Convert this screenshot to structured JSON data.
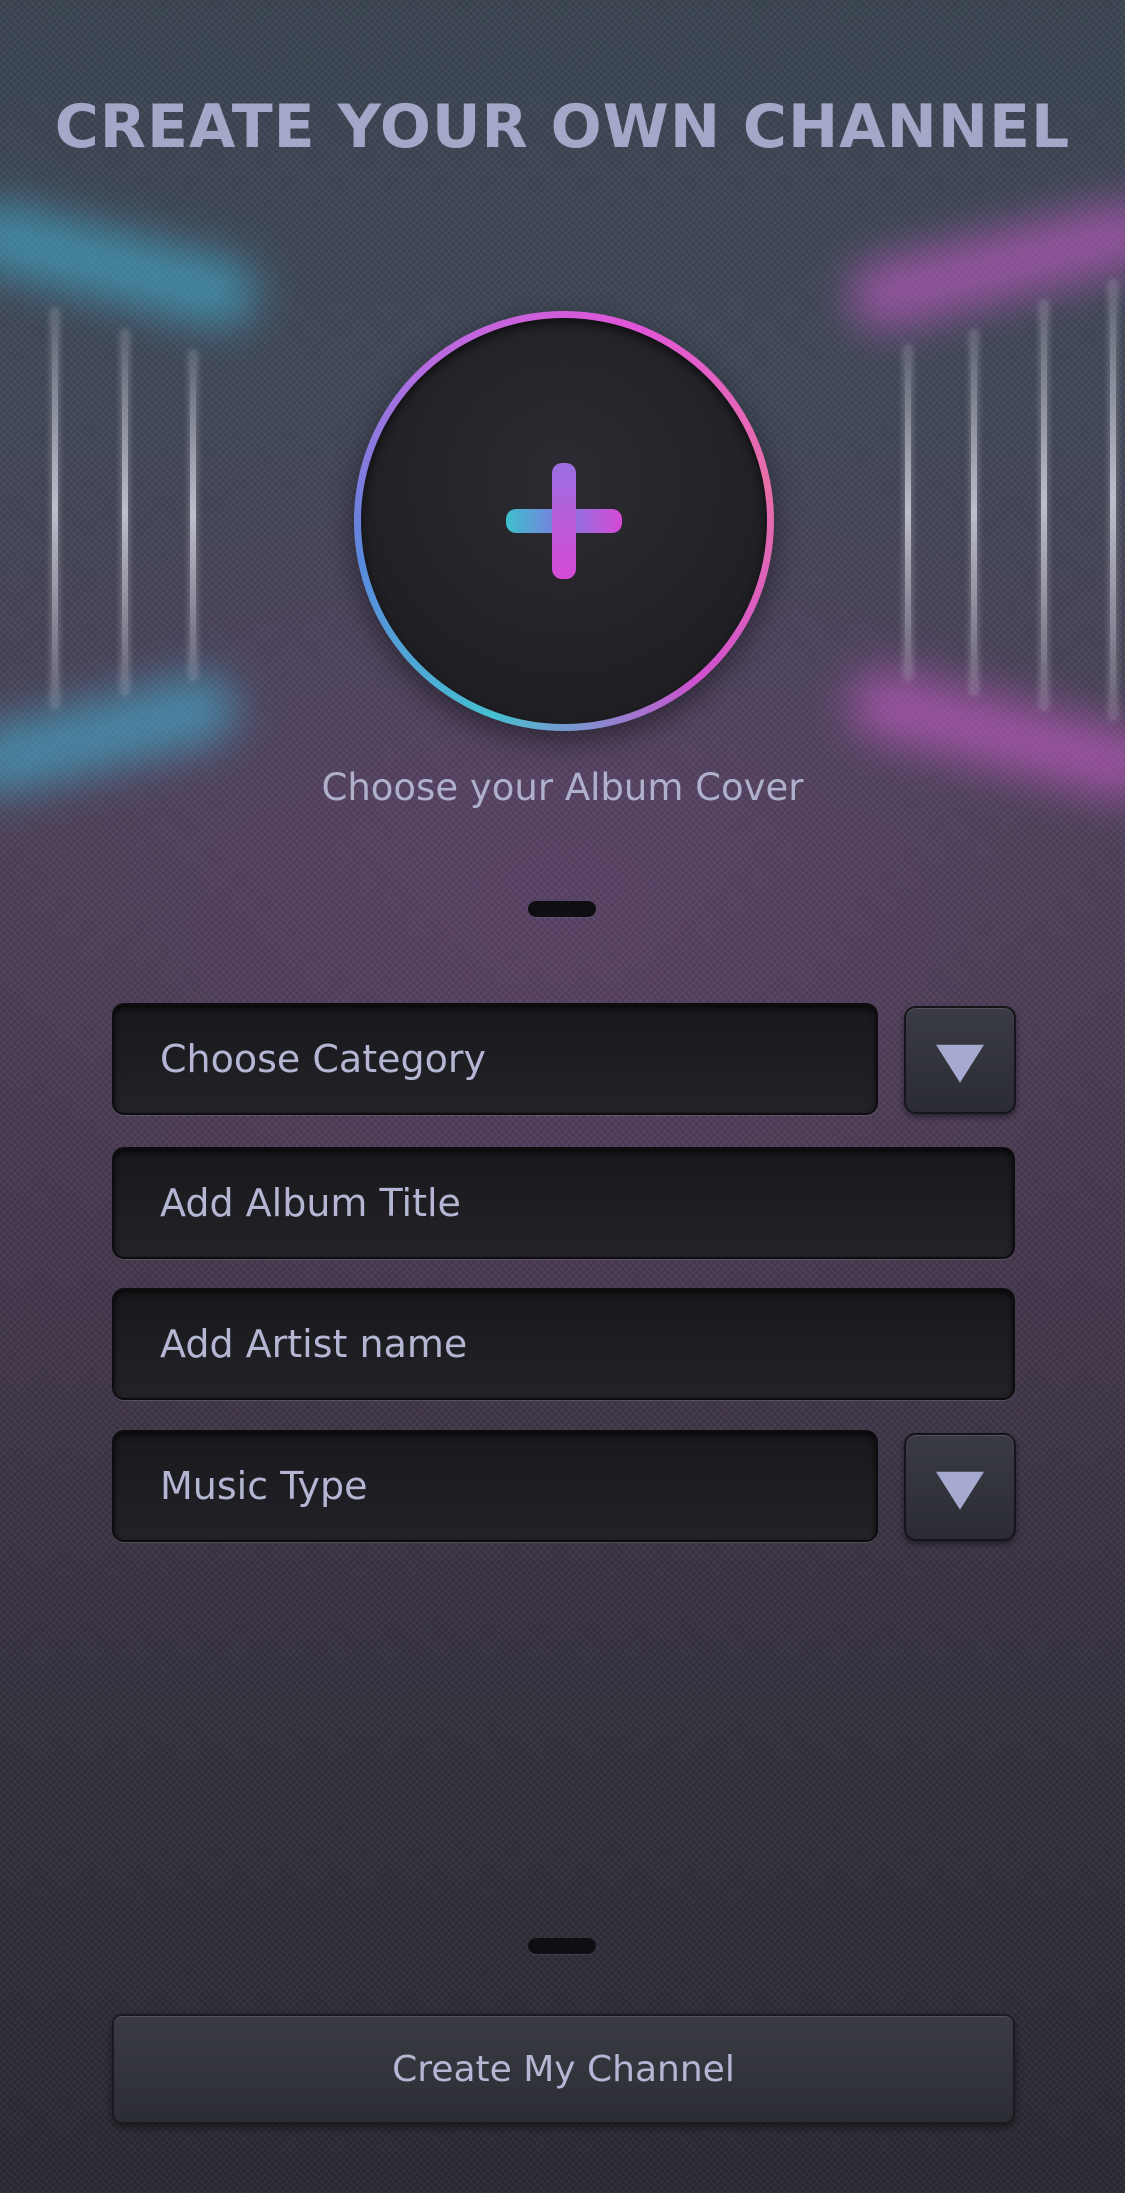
{
  "header": {
    "title": "CREATE YOUR OWN CHANNEL"
  },
  "album_cover": {
    "icon": "plus-icon",
    "caption": "Choose your Album Cover"
  },
  "form": {
    "category": {
      "placeholder": "Choose Category",
      "dropdown_icon": "triangle-down-icon"
    },
    "album_title": {
      "placeholder": "Add Album Title"
    },
    "artist_name": {
      "placeholder": "Add Artist name"
    },
    "music_type": {
      "placeholder": "Music Type",
      "dropdown_icon": "triangle-down-icon"
    }
  },
  "actions": {
    "create_label": "Create My Channel"
  },
  "colors": {
    "text_primary": "#a4a7c8",
    "accent_cyan": "#46c0d0",
    "accent_magenta": "#e055d8"
  }
}
